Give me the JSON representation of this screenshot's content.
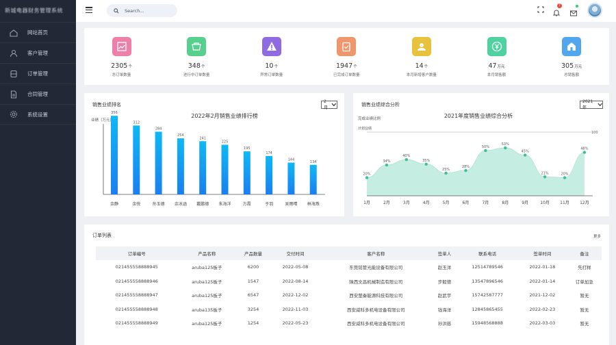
{
  "app": {
    "logo_text": "新城电器财务管理系统"
  },
  "sidebar": {
    "items": [
      {
        "label": "网站首页",
        "icon": "home-icon"
      },
      {
        "label": "客户管理",
        "icon": "user-icon"
      },
      {
        "label": "订单管理",
        "icon": "database-icon"
      },
      {
        "label": "合同管理",
        "icon": "document-icon"
      },
      {
        "label": "系统设置",
        "icon": "gear-icon"
      }
    ]
  },
  "header": {
    "search_placeholder": "Search...",
    "notification_count": "7"
  },
  "stats": [
    {
      "value": "2305",
      "unit": "个",
      "label": "总订单数量",
      "color": "#ee7fa8",
      "icon": "trend-chart-icon"
    },
    {
      "value": "348",
      "unit": "个",
      "label": "进行中订单数量",
      "color": "#57cf8f",
      "icon": "cart-icon"
    },
    {
      "value": "10",
      "unit": "个",
      "label": "异常订单数量",
      "color": "#8f6ae0",
      "icon": "warning-icon"
    },
    {
      "value": "1947",
      "unit": "个",
      "label": "已完成订单数量",
      "color": "#f0966d",
      "icon": "clipboard-check-icon"
    },
    {
      "value": "14",
      "unit": "个",
      "label": "本月新增客户数量",
      "color": "#e8c13d",
      "icon": "user-badge-icon"
    },
    {
      "value": "47",
      "unit": "万元",
      "label": "本月销售额",
      "color": "#4fd2a0",
      "icon": "yuan-icon"
    },
    {
      "value": "305",
      "unit": "万元",
      "label": "总销售额",
      "color": "#52a6ee",
      "icon": "house-icon"
    }
  ],
  "chart1": {
    "card_title": "销售业绩排名",
    "select": "2月",
    "chart_data": {
      "type": "bar",
      "title": "2022年2月销售业绩排行榜",
      "ylabel": "业绩（万元）",
      "categories": [
        "余静",
        "余悦",
        "孙玉德",
        "余冰涵",
        "戴鹏德",
        "朱海洋",
        "方霞",
        "于羽",
        "吴雨晴",
        "林海燕"
      ],
      "values": [
        356,
        312,
        284,
        254,
        241,
        225,
        195,
        174,
        144,
        134
      ],
      "ylim": [
        0,
        400
      ],
      "grid": false
    }
  },
  "chart2": {
    "card_title": "销售业绩综合分析",
    "select": "2021年",
    "chart_data": {
      "type": "area",
      "title": "2021年度销售业绩综合分析",
      "subtitle": "完成业绩比例",
      "target_label": "计划业绩",
      "target_value_label": "100",
      "categories": [
        "1月",
        "2月",
        "3月",
        "4月",
        "5月",
        "6月",
        "7月",
        "8月",
        "9月",
        "10月",
        "11月",
        "12月"
      ],
      "values": [
        20,
        34,
        40,
        35,
        25,
        28,
        50,
        53,
        45,
        21,
        20,
        48
      ],
      "value_suffix": "%",
      "ylim": [
        0,
        100
      ]
    }
  },
  "orders": {
    "title": "订单列表",
    "more": "更多",
    "columns": [
      "订单编号",
      "产品名称",
      "产品数量",
      "交付时间",
      "客户名称",
      "签单人",
      "联系电话",
      "签单时间",
      "备注"
    ],
    "rows": [
      [
        "021455558888945",
        "aruba125板子",
        "6200",
        "2022-05-08",
        "东莞铭管光能设备有限公司",
        "赵玉洋",
        "12514789546",
        "2022-01-18",
        "先打样"
      ],
      [
        "021455558888946",
        "aruba125板子",
        "1547",
        "2022-08-14",
        "陕西文昌机械制造有限公司",
        "步毅德",
        "13547896546",
        "2022-01-14",
        "订单加急"
      ],
      [
        "021455558888947",
        "aruba125板子",
        "6547",
        "2022-12-02",
        "西安楚秦能源科技有限公司",
        "赵武宇",
        "15742587777",
        "2021-12-02",
        "暂无"
      ],
      [
        "021455558888948",
        "aruba135板子",
        "3254",
        "2022-11-03",
        "西安威科多机电设备有限公司",
        "钱海洋",
        "12845865455",
        "2022-02-23",
        "暂无"
      ],
      [
        "021455558888949",
        "aruba125板子",
        "1254",
        "2022-05-23",
        "西安威科多机电设备有限公司",
        "孙洪慈",
        "15948568888",
        "2022-03-03",
        "暂无"
      ]
    ]
  }
}
